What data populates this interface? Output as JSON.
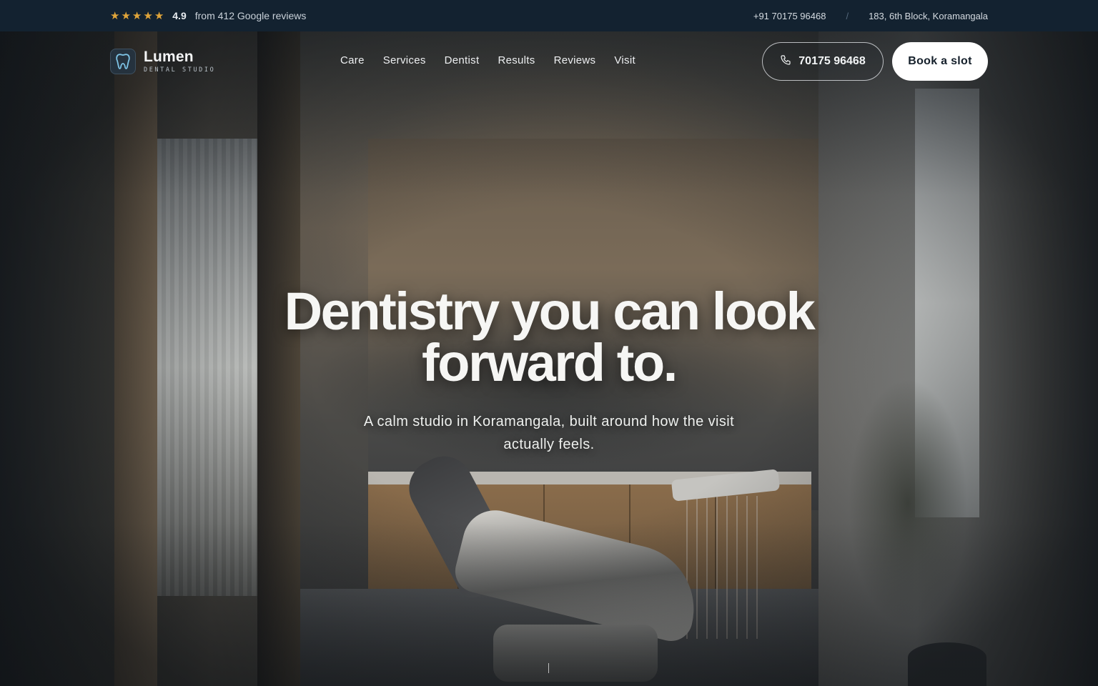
{
  "topbar": {
    "stars": [
      "★",
      "★",
      "★",
      "★",
      "★"
    ],
    "rating_value": "4.9",
    "rating_text": "from 412 Google reviews",
    "phone": "+91 70175 96468",
    "separator": "/",
    "address": "183, 6th Block, Koramangala"
  },
  "brand": {
    "name": "Lumen",
    "tagline": "DENTAL STUDIO",
    "icon": "tooth-icon"
  },
  "nav": {
    "links": [
      "Care",
      "Services",
      "Dentist",
      "Results",
      "Reviews",
      "Visit"
    ]
  },
  "actions": {
    "call_label": "70175 96468",
    "call_icon": "phone-icon",
    "book_label": "Book a slot"
  },
  "hero": {
    "headline": "Dentistry you can look forward to.",
    "subline": "A calm studio in Koramangala, built around how the visit actually feels."
  },
  "colors": {
    "topbar_bg": "#132230",
    "star": "#e0a53a",
    "brand_mark": "#7ec4e6",
    "book_bg": "#ffffff"
  }
}
